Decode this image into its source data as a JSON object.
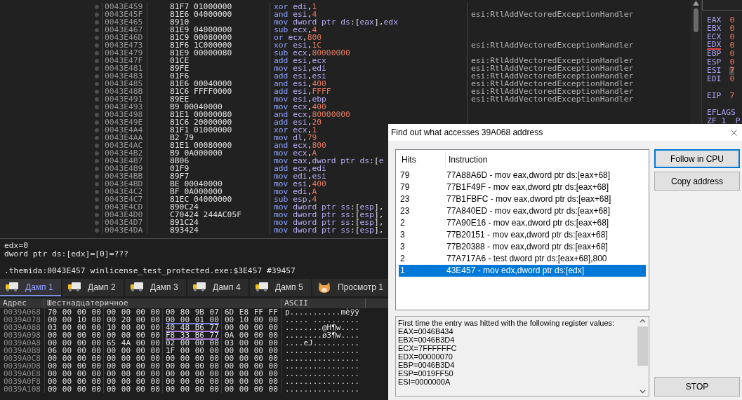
{
  "disassembly": {
    "rows": [
      {
        "address": "0043E459",
        "bytes": "81F7 01000000",
        "mnemonic": "xor",
        "operands": "edi,1"
      },
      {
        "address": "0043E45F",
        "bytes": "81E6 04000000",
        "mnemonic": "and",
        "operands": "esi,4",
        "comment": "esi:RtlAddVectoredExceptionHandler"
      },
      {
        "address": "0043E465",
        "bytes": "8910",
        "mnemonic": "mov",
        "operands": "dword ptr ds:[eax],edx"
      },
      {
        "address": "0043E467",
        "bytes": "81E9 04000000",
        "mnemonic": "sub",
        "operands": "ecx,4"
      },
      {
        "address": "0043E46D",
        "bytes": "81C9 00080000",
        "mnemonic": "or",
        "operands": "ecx,800"
      },
      {
        "address": "0043E473",
        "bytes": "81F6 1C000000",
        "mnemonic": "xor",
        "operands": "esi,1C",
        "comment": "esi:RtlAddVectoredExceptionHandler"
      },
      {
        "address": "0043E479",
        "bytes": "81E9 00000080",
        "mnemonic": "sub",
        "operands": "ecx,80000000"
      },
      {
        "address": "0043E47F",
        "bytes": "01CE",
        "mnemonic": "add",
        "operands": "esi,ecx",
        "comment": "esi:RtlAddVectoredExceptionHandler"
      },
      {
        "address": "0043E481",
        "bytes": "89FE",
        "mnemonic": "mov",
        "operands": "esi,edi",
        "comment": "esi:RtlAddVectoredExceptionHandler"
      },
      {
        "address": "0043E483",
        "bytes": "01F6",
        "mnemonic": "add",
        "operands": "esi,esi",
        "comment": "esi:RtlAddVectoredExceptionHandler"
      },
      {
        "address": "0043E485",
        "bytes": "81E6 00040000",
        "mnemonic": "and",
        "operands": "esi,400",
        "comment": "esi:RtlAddVectoredExceptionHandler"
      },
      {
        "address": "0043E48B",
        "bytes": "81C6 FFFF0000",
        "mnemonic": "add",
        "operands": "esi,FFFF",
        "comment": "esi:RtlAddVectoredExceptionHandler"
      },
      {
        "address": "0043E491",
        "bytes": "89EE",
        "mnemonic": "mov",
        "operands": "esi,ebp",
        "comment": "esi:RtlAddVectoredExceptionHandler"
      },
      {
        "address": "0043E493",
        "bytes": "B9 00040000",
        "mnemonic": "mov",
        "operands": "ecx,400"
      },
      {
        "address": "0043E498",
        "bytes": "81E1 00000080",
        "mnemonic": "and",
        "operands": "ecx,80000000"
      },
      {
        "address": "0043E49E",
        "bytes": "81C6 20000000",
        "mnemonic": "add",
        "operands": "esi,20"
      },
      {
        "address": "0043E4A4",
        "bytes": "81F1 01000000",
        "mnemonic": "xor",
        "operands": "ecx,1"
      },
      {
        "address": "0043E4AA",
        "bytes": "B2 79",
        "mnemonic": "mov",
        "operands": "dl,79"
      },
      {
        "address": "0043E4AC",
        "bytes": "81E1 00080000",
        "mnemonic": "and",
        "operands": "ecx,800"
      },
      {
        "address": "0043E4B2",
        "bytes": "B9 0A000000",
        "mnemonic": "mov",
        "operands": "ecx,A"
      },
      {
        "address": "0043E4B7",
        "bytes": "8B06",
        "mnemonic": "mov",
        "operands": "eax,dword ptr ds:[e"
      },
      {
        "address": "0043E4B9",
        "bytes": "01F9",
        "mnemonic": "add",
        "operands": "ecx,edi"
      },
      {
        "address": "0043E4BB",
        "bytes": "89F7",
        "mnemonic": "mov",
        "operands": "edi,esi"
      },
      {
        "address": "0043E4BD",
        "bytes": "BE 00040000",
        "mnemonic": "mov",
        "operands": "esi,400"
      },
      {
        "address": "0043E4C2",
        "bytes": "BF 0A000000",
        "mnemonic": "mov",
        "operands": "edi,A"
      },
      {
        "address": "0043E4C7",
        "bytes": "81EC 04000000",
        "mnemonic": "sub",
        "operands": "esp,4"
      },
      {
        "address": "0043E4CD",
        "bytes": "890C24",
        "mnemonic": "mov",
        "operands": "dword ptr ss:[esp],"
      },
      {
        "address": "0043E4D0",
        "bytes": "C70424 244AC05F",
        "mnemonic": "mov",
        "operands": "dword ptr ss:[esp],"
      },
      {
        "address": "0043E4D7",
        "bytes": "891C24",
        "mnemonic": "mov",
        "operands": "dword ptr ss:[esp],"
      },
      {
        "address": "0043E4DA",
        "bytes": "893424",
        "mnemonic": "mov",
        "operands": "dword ptr ss:[esp],"
      }
    ]
  },
  "registers": {
    "general": [
      {
        "name": "EAX",
        "value": "0",
        "underlined": false,
        "highlighted": false
      },
      {
        "name": "EBX",
        "value": "0",
        "underlined": false,
        "highlighted": false
      },
      {
        "name": "ECX",
        "value": "0",
        "underlined": false,
        "highlighted": false
      },
      {
        "name": "EDX",
        "value": "0",
        "underlined": true,
        "highlighted": false
      },
      {
        "name": "EBP",
        "value": "0",
        "underlined": false,
        "highlighted": false
      },
      {
        "name": "ESP",
        "value": "0",
        "underlined": false,
        "highlighted": false
      },
      {
        "name": "ESI",
        "value": "7",
        "underlined": false,
        "highlighted": true
      },
      {
        "name": "EDI",
        "value": "0",
        "underlined": false,
        "highlighted": false
      }
    ],
    "eip": {
      "name": "EIP",
      "value": "7"
    },
    "eflags": "EFLAGS",
    "flags_line": "ZF 1  P"
  },
  "info": {
    "lines": [
      "edx=0",
      "dword ptr ds:[edx]=[0]=???"
    ],
    "location": ".themida:0043E457 winlicense_test_protected.exe:$3E457 #39457"
  },
  "tabs": [
    {
      "label": "Дамп 1",
      "kind": "dump",
      "selected": true
    },
    {
      "label": "Дамп 2",
      "kind": "dump",
      "selected": false
    },
    {
      "label": "Дамп 3",
      "kind": "dump",
      "selected": false
    },
    {
      "label": "Дамп 4",
      "kind": "dump",
      "selected": false
    },
    {
      "label": "Дамп 5",
      "kind": "dump",
      "selected": false
    },
    {
      "label": "Просмотр 1",
      "kind": "watch",
      "selected": false
    }
  ],
  "dump": {
    "columns": [
      "Адрес",
      "Шестнадцатеричное",
      "ASCII"
    ],
    "rows": [
      {
        "address": "0039A068",
        "hex": [
          "70 00 00 00",
          "00 00 00 00",
          "00 80 9B 07",
          "6D E8 FF FF"
        ],
        "ascii": "p...........mèÿÿ"
      },
      {
        "address": "0039A078",
        "hex": [
          "00 00 10 00",
          "00 20 00 00",
          "00 00 01 00",
          "00 10 00 00"
        ],
        "ascii": "..... ..........",
        "color": "#7382e0"
      },
      {
        "address": "0039A088",
        "hex": [
          "03 00 00 00",
          "10 00 00 00",
          "40 48 B6 77",
          "00 00 00 00"
        ],
        "ascii": "........@H¶w....",
        "color": "#a77ad8"
      },
      {
        "address": "0039A098",
        "hex": [
          "00 00 00 00",
          "00 00 00 00",
          "F8 33 B6 77",
          "0A 00 00 00"
        ],
        "ascii": "........ø3¶w....",
        "color": "#a77ad8"
      },
      {
        "address": "0039A0A8",
        "hex": [
          "00 00 00 00",
          "65 4A 00 00",
          "02 00 00 00",
          "03 00 00 00"
        ],
        "ascii": "....eJ.........."
      },
      {
        "address": "0039A0B8",
        "hex": [
          "06 00 00 00",
          "00 00 00 00",
          "1F 00 00 00",
          "00 00 00 00"
        ],
        "ascii": "................"
      },
      {
        "address": "0039A0C8",
        "hex": [
          "00 00 00 00",
          "00 00 00 00",
          "00 00 00 00",
          "00 00 00 00"
        ],
        "ascii": "................"
      },
      {
        "address": "0039A0D8",
        "hex": [
          "00 00 00 00",
          "00 00 00 00",
          "00 00 00 00",
          "00 00 00 00"
        ],
        "ascii": "................"
      },
      {
        "address": "0039A0E8",
        "hex": [
          "00 00 00 00",
          "00 00 00 00",
          "00 00 00 00",
          "00 00 00 00"
        ],
        "ascii": "................"
      },
      {
        "address": "0039A0F8",
        "hex": [
          "00 00 00 00",
          "00 00 00 00",
          "00 00 00 00",
          "00 00 00 00"
        ],
        "ascii": "................"
      },
      {
        "address": "0039A108",
        "hex": [
          "00 00 00 00",
          "00 00 00 00",
          "00 00 00 00",
          "00 00 00 00"
        ],
        "ascii": "................"
      }
    ]
  },
  "dialog": {
    "title": "Find out what accesses 39A068 address",
    "columns": [
      "Hits",
      "Instruction"
    ],
    "rows": [
      {
        "hits": "79",
        "instruction": "77A88A6D - mov eax,dword ptr ds:[eax+68]",
        "selected": false
      },
      {
        "hits": "79",
        "instruction": "77B1F49F - mov eax,dword ptr ds:[eax+68]",
        "selected": false
      },
      {
        "hits": "23",
        "instruction": "77B1FBFC - mov eax,dword ptr ds:[eax+68]",
        "selected": false
      },
      {
        "hits": "23",
        "instruction": "77A840ED - mov eax,dword ptr ds:[eax+68]",
        "selected": false
      },
      {
        "hits": "2",
        "instruction": "77A90E16 - mov eax,dword ptr ds:[eax+68]",
        "selected": false
      },
      {
        "hits": "3",
        "instruction": "77B20151 - mov eax,dword ptr ds:[eax+68]",
        "selected": false
      },
      {
        "hits": "3",
        "instruction": "77B20388 - mov eax,dword ptr ds:[eax+68]",
        "selected": false
      },
      {
        "hits": "2",
        "instruction": "77A717A6 - test dword ptr ds:[eax+68],800",
        "selected": false
      },
      {
        "hits": "1",
        "instruction": "43E457 - mov edx,dword ptr ds:[edx]",
        "selected": true
      }
    ],
    "buttons": [
      {
        "label": "Follow in CPU",
        "focused": true
      },
      {
        "label": "Copy address",
        "focused": false
      }
    ],
    "log": [
      "First time the entry was hitted with the following register values:",
      "EAX=0046B434",
      "EBX=0046B3D4",
      "ECX=7FFFFFFC",
      "EDX=00000070",
      "EBP=0046B3D4",
      "ESP=0019FF50",
      "ESI=0000000A"
    ],
    "stop_button": "STOP"
  }
}
